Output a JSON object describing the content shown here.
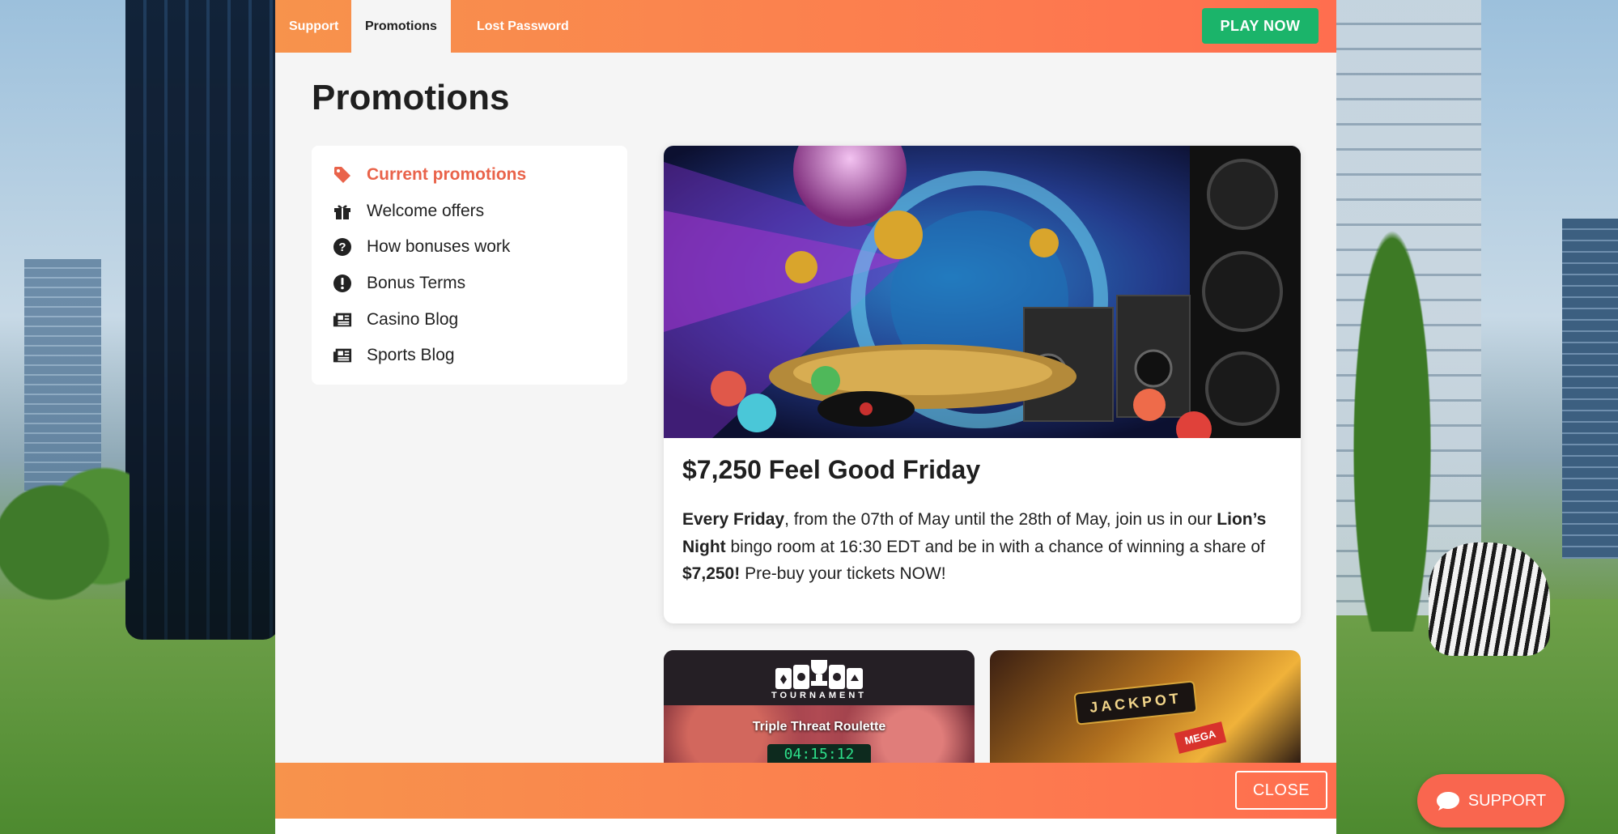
{
  "nav": {
    "tabs": [
      {
        "label": "Support",
        "active": false
      },
      {
        "label": "Promotions",
        "active": true
      },
      {
        "label": "Lost Password",
        "active": false
      }
    ],
    "play_now": "PLAY NOW"
  },
  "page": {
    "title": "Promotions"
  },
  "sidebar": {
    "items": [
      {
        "label": "Current promotions",
        "icon": "tag-icon",
        "active": true
      },
      {
        "label": "Welcome offers",
        "icon": "gift-icon",
        "active": false
      },
      {
        "label": "How bonuses work",
        "icon": "question-circle-icon",
        "active": false
      },
      {
        "label": "Bonus Terms",
        "icon": "exclamation-circle-icon",
        "active": false
      },
      {
        "label": "Casino Blog",
        "icon": "newspaper-icon",
        "active": false
      },
      {
        "label": "Sports Blog",
        "icon": "newspaper-icon",
        "active": false
      }
    ]
  },
  "promo": {
    "title": "$7,250 Feel Good Friday",
    "text_parts": [
      {
        "t": "Every Friday",
        "b": true
      },
      {
        "t": ", from the 07th of May until the 28th of May, join us in our ",
        "b": false
      },
      {
        "t": "Lion’s Night",
        "b": true
      },
      {
        "t": " bingo room at 16:30 EDT and be in with a chance of winning a share of ",
        "b": false
      },
      {
        "t": "$7,250!",
        "b": true
      },
      {
        "t": " Pre-buy your tickets NOW!",
        "b": false
      }
    ]
  },
  "cards": {
    "tournament": {
      "label": "TOURNAMENT",
      "subtitle": "Triple Threat Roulette",
      "timer": "04:15:12"
    },
    "jackpot": {
      "label": "JACKPOT",
      "badge": "MEGA"
    }
  },
  "footer": {
    "close": "CLOSE"
  },
  "support": {
    "label": "SUPPORT"
  },
  "colors": {
    "accent_orange": "#fd7a4f",
    "play_green": "#1bb46a",
    "active_item": "#e9634a",
    "support_button": "#f9664f"
  }
}
